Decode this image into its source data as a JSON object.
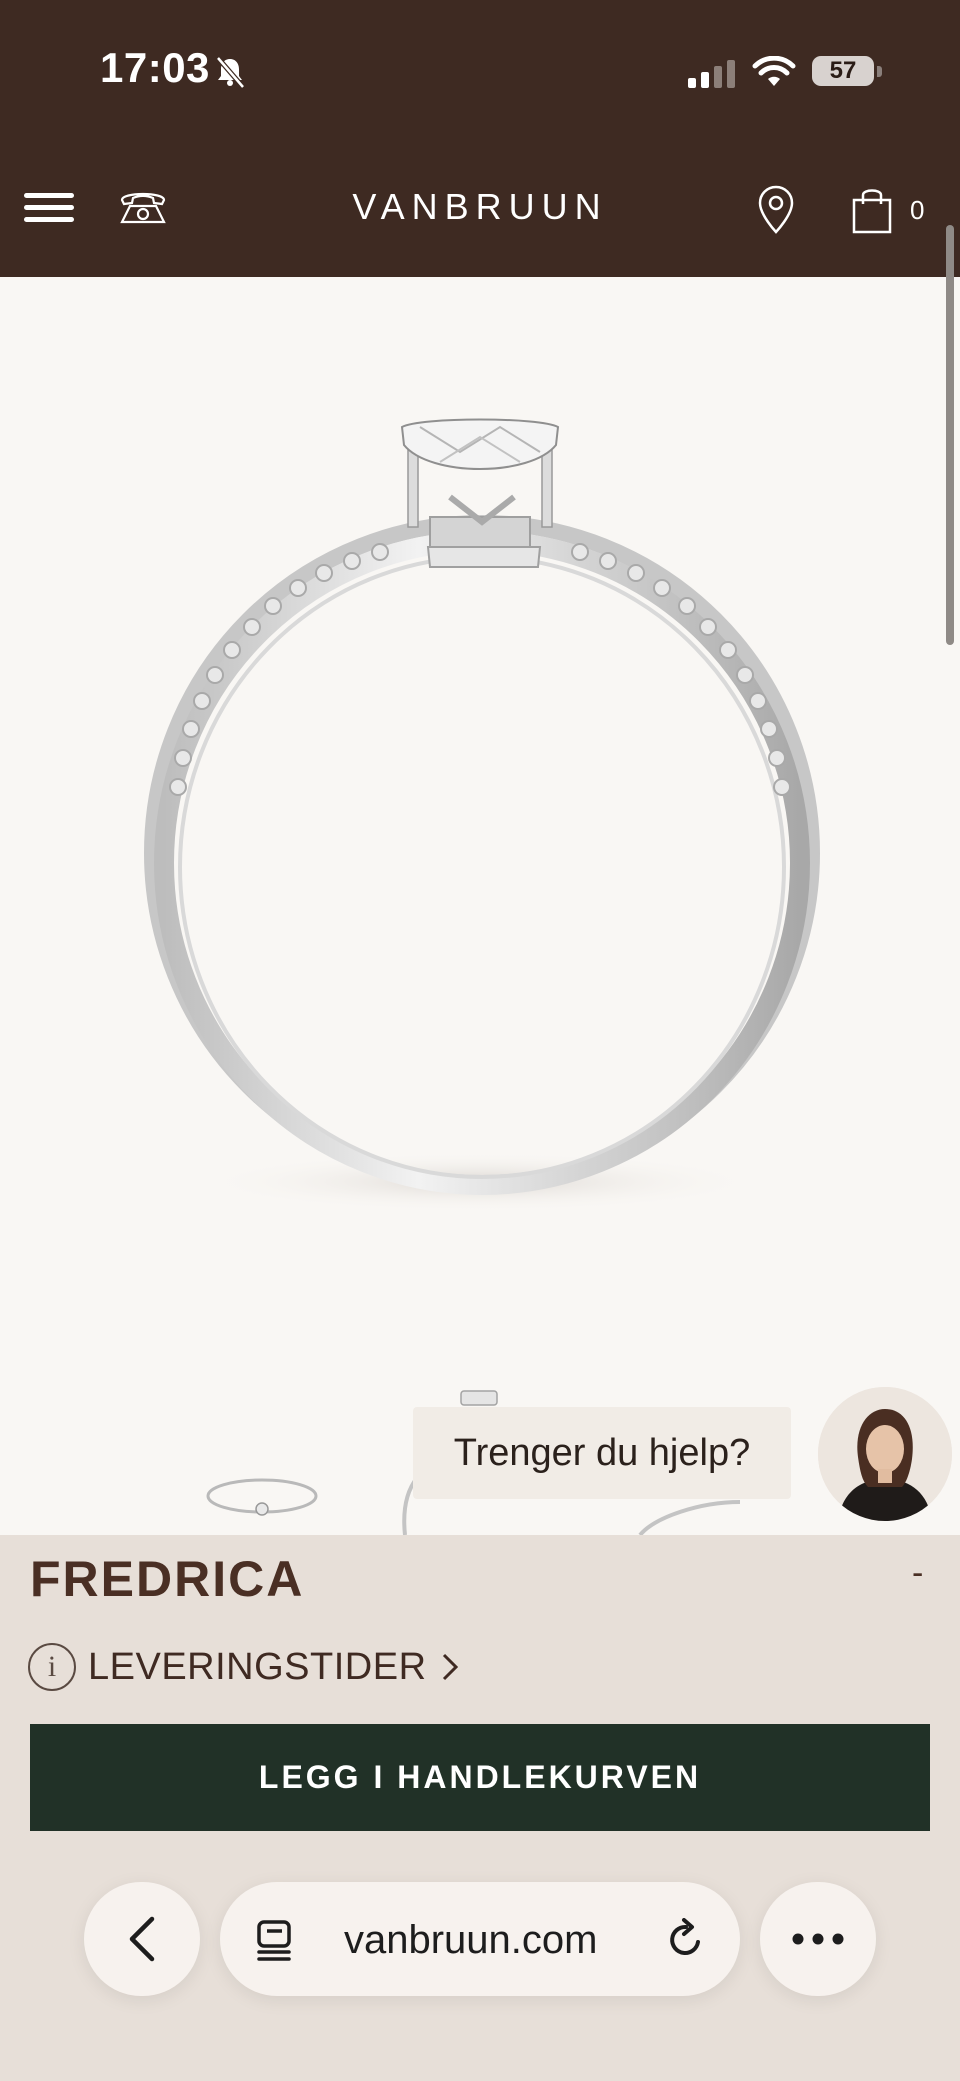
{
  "status_bar": {
    "time": "17:03",
    "battery": "57",
    "icons": [
      "bell-slash-icon",
      "signal-icon",
      "wifi-icon",
      "battery-icon"
    ]
  },
  "header": {
    "brand": "VANBRUUN",
    "cart_count": "0",
    "icons": [
      "menu-icon",
      "phone-icon",
      "location-pin-icon",
      "shopping-bag-icon"
    ],
    "background_color": "#3e2a22"
  },
  "chat": {
    "prompt": "Trenger du hjelp?"
  },
  "product": {
    "name": "FREDRICA",
    "collapse_symbol": "-",
    "delivery_label": "LEVERINGSTIDER",
    "add_to_cart_label": "LEGG I HANDLEKURVEN",
    "button_color": "#213127",
    "panel_color": "#e7dfd8"
  },
  "browser": {
    "url": "vanbruun.com",
    "icons": [
      "back-chevron-icon",
      "tabs-icon",
      "reload-icon",
      "more-icon"
    ]
  }
}
